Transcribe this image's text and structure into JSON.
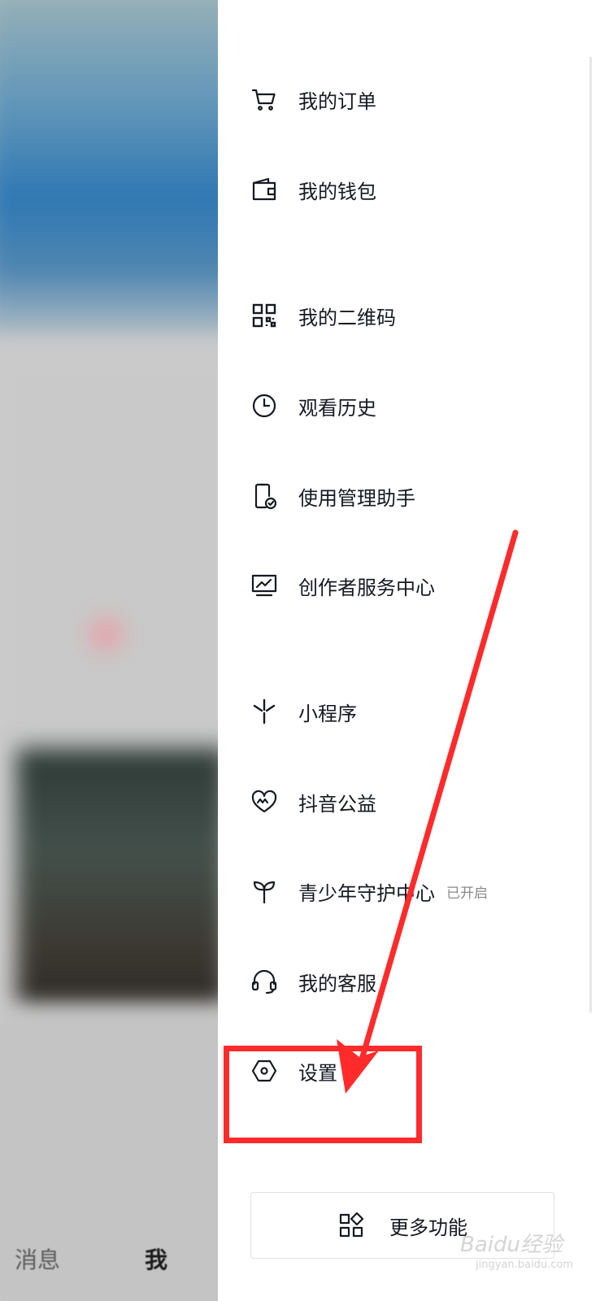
{
  "background_app": {
    "bottom_nav": {
      "messages_label": "消息",
      "me_label": "我"
    }
  },
  "drawer": {
    "menu_items": [
      {
        "label": "我的订单",
        "icon": "cart-icon"
      },
      {
        "label": "我的钱包",
        "icon": "wallet-icon"
      },
      {
        "label": "我的二维码",
        "icon": "qrcode-icon"
      },
      {
        "label": "观看历史",
        "icon": "clock-icon"
      },
      {
        "label": "使用管理助手",
        "icon": "phone-check-icon"
      },
      {
        "label": "创作者服务中心",
        "icon": "chart-monitor-icon"
      },
      {
        "label": "小程序",
        "icon": "mini-program-icon"
      },
      {
        "label": "抖音公益",
        "icon": "heart-charity-icon"
      },
      {
        "label": "青少年守护中心",
        "icon": "sprout-icon",
        "badge": "已开启"
      },
      {
        "label": "我的客服",
        "icon": "headset-icon"
      },
      {
        "label": "设置",
        "icon": "settings-hexagon-icon"
      }
    ],
    "more_button": {
      "label": "更多功能",
      "icon": "apps-grid-icon"
    }
  },
  "annotation": {
    "color": "#ff2b2b"
  },
  "watermark": {
    "text": "Baidu经验",
    "sub": "jingyan.baidu.com"
  }
}
